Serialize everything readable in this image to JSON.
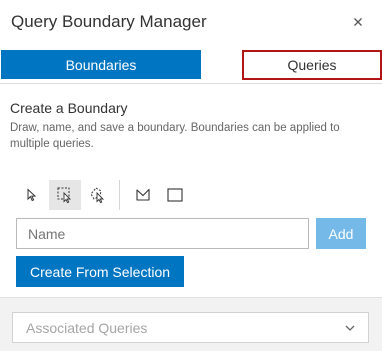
{
  "panel": {
    "title": "Query Boundary Manager",
    "close_icon": "close-icon"
  },
  "tabs": [
    {
      "label": "Boundaries",
      "active": true
    },
    {
      "label": "Queries",
      "active": false
    }
  ],
  "create_boundary": {
    "title": "Create a Boundary",
    "description": "Draw, name, and save a boundary. Boundaries can be applied to multiple queries."
  },
  "tools": [
    {
      "icon": "pointer-select-icon",
      "active": false
    },
    {
      "icon": "rectangle-select-icon",
      "active": true
    },
    {
      "icon": "lasso-select-icon",
      "active": false
    },
    {
      "icon": "draw-polygon-icon",
      "active": false
    },
    {
      "icon": "draw-rectangle-icon",
      "active": false
    }
  ],
  "name_input": {
    "placeholder": "Name",
    "value": ""
  },
  "buttons": {
    "add": "Add",
    "create_from_selection": "Create From Selection"
  },
  "associated_queries": {
    "placeholder": "Associated Queries",
    "icon": "chevron-down-icon"
  },
  "colors": {
    "primary": "#0075c2",
    "primary_disabled": "#74b9e7",
    "highlight_border": "#b21515",
    "footer_bg": "#f2f2f2"
  }
}
